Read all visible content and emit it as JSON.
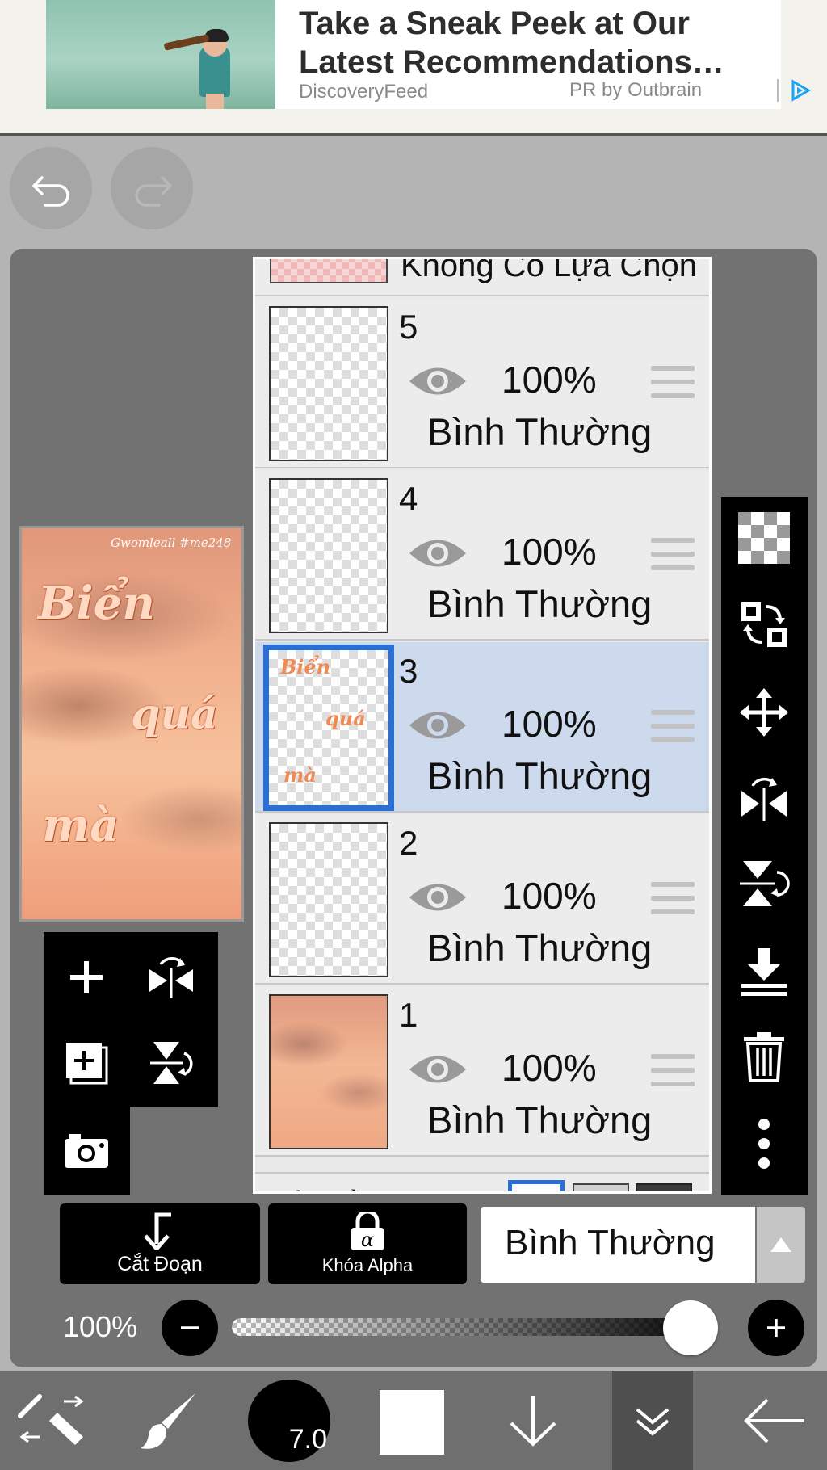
{
  "ad": {
    "title": "Take a Sneak Peek at Our Latest Recommendations…",
    "source": "DiscoveryFeed",
    "sponsor": "PR by Outbrain",
    "icon": "adchoices-icon"
  },
  "history": {
    "undo_icon": "undo-icon",
    "redo_icon": "redo-icon"
  },
  "layers": {
    "none_label": "Không Có Lựa Chọn",
    "items": [
      {
        "number": "5",
        "opacity": "100%",
        "blend": "Bình Thường",
        "visible": true,
        "selected": false
      },
      {
        "number": "4",
        "opacity": "100%",
        "blend": "Bình Thường",
        "visible": true,
        "selected": false
      },
      {
        "number": "3",
        "opacity": "100%",
        "blend": "Bình Thường",
        "visible": true,
        "selected": true
      },
      {
        "number": "2",
        "opacity": "100%",
        "blend": "Bình Thường",
        "visible": true,
        "selected": false
      },
      {
        "number": "1",
        "opacity": "100%",
        "blend": "Bình Thường",
        "visible": true,
        "selected": false
      }
    ],
    "bottom_label": "Màu Nền"
  },
  "preview": {
    "signature": "Gwomleall #me248",
    "words": [
      "Biển",
      "quá",
      "mà"
    ]
  },
  "layer_thumb_words": [
    "Biển",
    "quá",
    "mà"
  ],
  "actions": {
    "clip_label": "Cắt Đoạn",
    "alpha_lock_label": "Khóa Alpha",
    "alpha_glyph": "α",
    "blend_mode": "Bình Thường"
  },
  "opacity": {
    "label": "100%",
    "value": 1.0
  },
  "toolbar": {
    "brush_size": "7.0",
    "color": "#ffffff"
  },
  "colors": {
    "selected_layer_bg": "#cdd9ec",
    "selection_border": "#2a6fd6",
    "panel_bg": "#727272"
  }
}
